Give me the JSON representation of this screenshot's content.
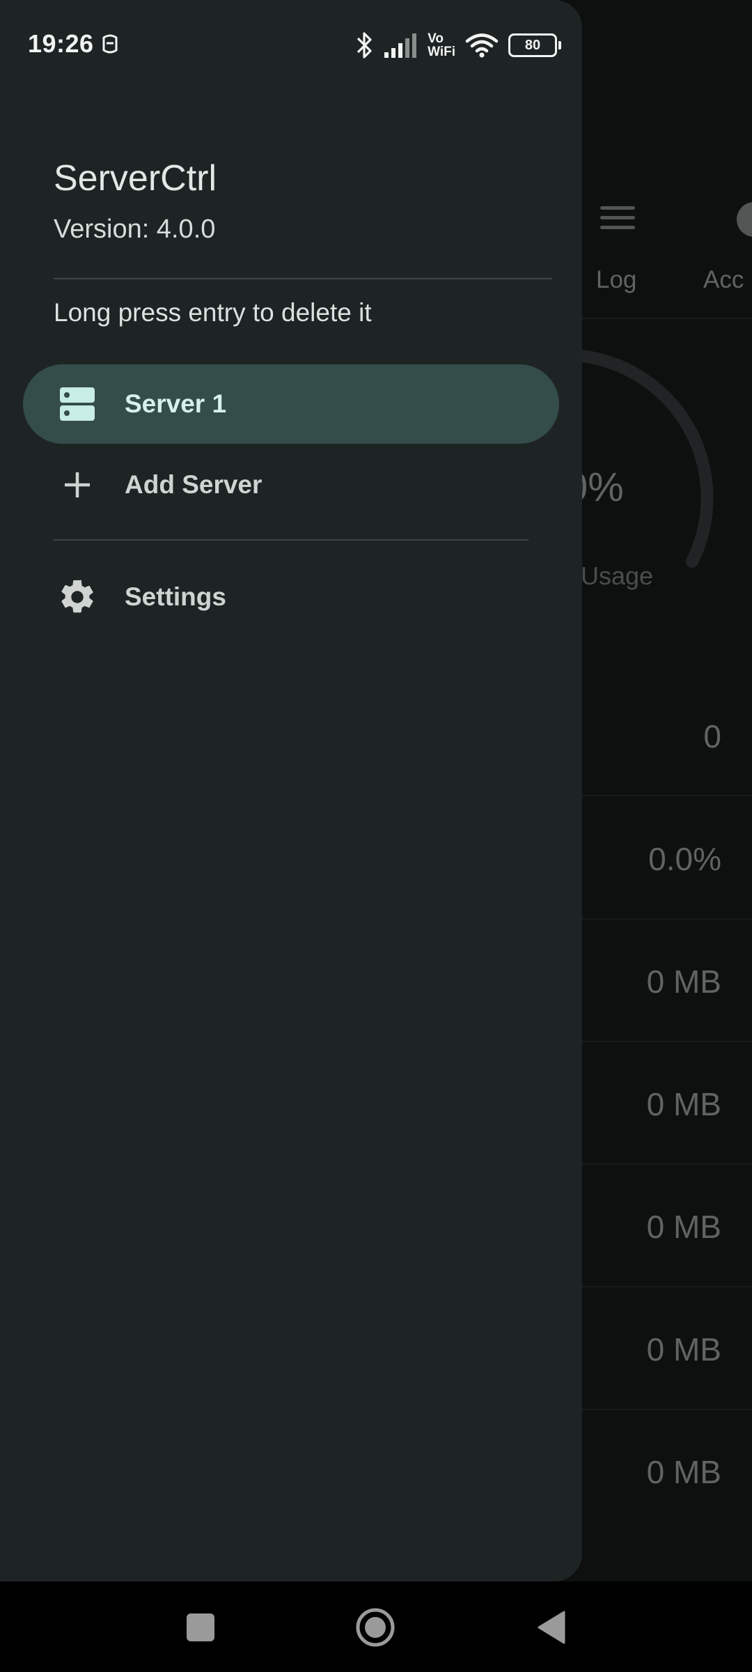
{
  "status_bar": {
    "time": "19:26",
    "vowifi_top": "Vo",
    "vowifi_bottom": "WiFi",
    "battery": "80"
  },
  "background": {
    "tabs": [
      "Log",
      "Acc"
    ],
    "gauge_percent_text": "0%",
    "gauge_caption": "Usage",
    "rows": [
      "0",
      "0.0%",
      "0 MB",
      "0 MB",
      "0 MB",
      "0 MB",
      "0 MB"
    ]
  },
  "drawer": {
    "app_title": "ServerCtrl",
    "version": "Version: 4.0.0",
    "hint": "Long press entry to delete it",
    "items": [
      {
        "label": "Server 1",
        "icon": "server-icon",
        "active": true
      },
      {
        "label": "Add Server",
        "icon": "plus-icon",
        "active": false
      },
      {
        "label": "Settings",
        "icon": "gear-icon",
        "active": false
      }
    ]
  },
  "colors": {
    "drawer_bg": "#1e2424",
    "active_item_bg": "#344d4b",
    "accent_icon": "#c8ece6"
  }
}
